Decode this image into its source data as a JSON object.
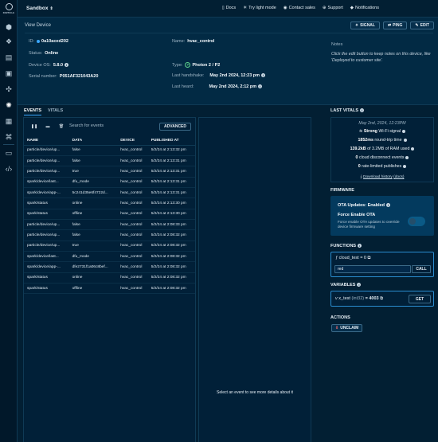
{
  "brand": {
    "name": "PARTICLE"
  },
  "topbar": {
    "org": "Sandbox",
    "links": [
      {
        "icon": "doc-icon",
        "label": "Docs"
      },
      {
        "icon": "sun-icon",
        "label": "Try light mode"
      },
      {
        "icon": "chat-icon",
        "label": "Contact sales"
      },
      {
        "icon": "help-icon",
        "label": "Support"
      }
    ],
    "notifications": "Notifications"
  },
  "header": {
    "title": "View Device",
    "buttons": {
      "signal": "SIGNAL",
      "ping": "PING",
      "edit": "EDIT"
    },
    "id_label": "ID:",
    "id_value": "0a10aced202",
    "status_label": "Status:",
    "status_value": "Online",
    "os_label": "Device OS:",
    "os_value": "5.8.0",
    "serial_label": "Serial number:",
    "serial_value": "P051AF321043A20",
    "name_label": "Name:",
    "name_value": "hvac_control",
    "type_label": "Type:",
    "type_value": "Photon 2 / P2",
    "handshake_label": "Last handshake:",
    "handshake_value": "May 2nd 2024, 12:23 pm",
    "heard_label": "Last heard:",
    "heard_value": "May 2nd 2024, 2:12 pm",
    "notes_title": "Notes",
    "notes_body": "Click the edit button to keep notes on this device, like 'Deployed to customer site'."
  },
  "tabs": {
    "events": "EVENTS",
    "vitals": "VITALS"
  },
  "events": {
    "search_placeholder": "Search for events",
    "advanced": "ADVANCED",
    "columns": [
      "NAME",
      "DATA",
      "DEVICE",
      "PUBLISHED AT"
    ],
    "rows": [
      [
        "particle/device/up...",
        "false",
        "hvac_control",
        "5/2/24 at 2:13:32 pm"
      ],
      [
        "particle/device/up...",
        "false",
        "hvac_control",
        "5/2/24 at 2:13:31 pm"
      ],
      [
        "particle/device/up...",
        "true",
        "hvac_control",
        "5/2/24 at 2:13:31 pm"
      ],
      [
        "spark/device/last...",
        "dfu_mode",
        "hvac_control",
        "5/2/24 at 2:13:31 pm"
      ],
      [
        "spark/device/app-...",
        "5c241d35e6f4722d...",
        "hvac_control",
        "5/2/24 at 2:13:31 pm"
      ],
      [
        "spark/status",
        "online",
        "hvac_control",
        "5/2/24 at 2:13:30 pm"
      ],
      [
        "spark/status",
        "offline",
        "hvac_control",
        "5/2/24 at 2:13:30 pm"
      ],
      [
        "particle/device/up...",
        "false",
        "hvac_control",
        "5/2/24 at 2:08:33 pm"
      ],
      [
        "particle/device/up...",
        "false",
        "hvac_control",
        "5/2/24 at 2:08:32 pm"
      ],
      [
        "particle/device/up...",
        "true",
        "hvac_control",
        "5/2/24 at 2:08:32 pm"
      ],
      [
        "spark/device/last...",
        "dfu_mode",
        "hvac_control",
        "5/2/24 at 2:08:32 pm"
      ],
      [
        "spark/device/app-...",
        "dfe2731f1a06c8bef...",
        "hvac_control",
        "5/2/24 at 2:08:32 pm"
      ],
      [
        "spark/status",
        "online",
        "hvac_control",
        "5/2/24 at 2:08:32 pm"
      ],
      [
        "spark/status",
        "offline",
        "hvac_control",
        "5/2/24 at 2:08:32 pm"
      ]
    ],
    "detail_empty": "Select an event to see more details about it"
  },
  "vitals": {
    "title": "LAST VITALS",
    "timestamp": "May 2nd, 2024, 12:23PM",
    "signal_strength": "Strong",
    "signal_suffix": "Wi-Fi signal",
    "round_trip_value": "1852ms",
    "round_trip_suffix": "round-trip time",
    "ram_value": "139.2kB",
    "ram_suffix": "of 3.2MB of RAM used",
    "disconnects_value": "0",
    "disconnects_suffix": "cloud disconnect events",
    "rate_value": "0",
    "rate_suffix": "rate-limited publishes",
    "download": "Download history",
    "docs": "(docs)"
  },
  "firmware": {
    "title": "FIRMWARE",
    "ota_updates": "OTA Updates: Enabled",
    "force_title": "Force Enable OTA",
    "force_desc": "Force enable OTA updates to override device firmware setting",
    "force_enabled": false
  },
  "functions": {
    "title": "FUNCTIONS",
    "signature": "cloud_test = 0",
    "input_value": "red",
    "call": "CALL"
  },
  "variables": {
    "title": "VARIABLES",
    "name": "x_test",
    "type": "(int32)",
    "value": "= 4003",
    "get": "GET"
  },
  "actions": {
    "title": "ACTIONS",
    "unclaim": "UNCLAIM"
  },
  "colors": {
    "accent": "#3aa7ff",
    "background": "#021f33",
    "online": "#3aa7ff"
  }
}
